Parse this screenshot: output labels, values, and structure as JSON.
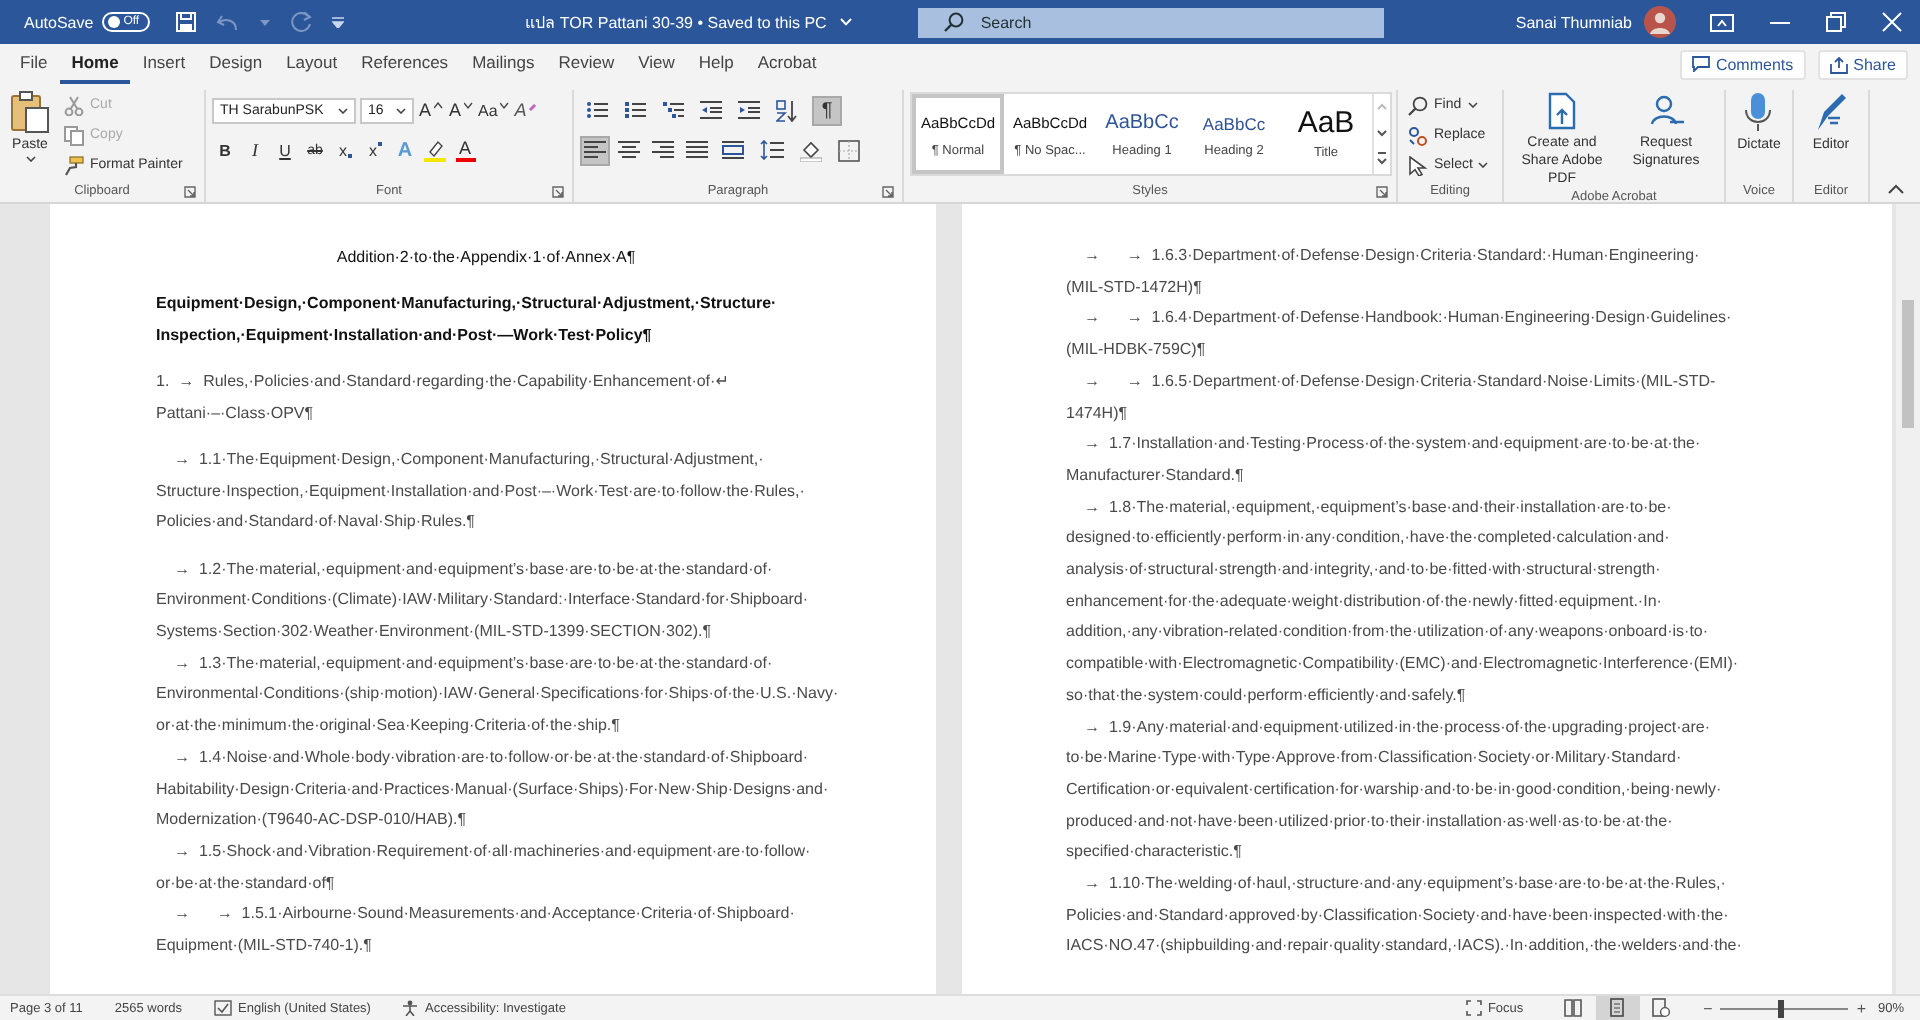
{
  "title_bar": {
    "autosave_label": "AutoSave",
    "autosave": {
      "text": "Off",
      "on": false
    },
    "document_title": "แปล TOR Pattani 30-39 • Saved to this PC",
    "search": {
      "placeholder": "Search"
    },
    "user_name": "Sanai Thumniab"
  },
  "ribbon_tabs": [
    {
      "label": "File",
      "selected": false
    },
    {
      "label": "Home",
      "selected": true
    },
    {
      "label": "Insert",
      "selected": false
    },
    {
      "label": "Design",
      "selected": false
    },
    {
      "label": "Layout",
      "selected": false
    },
    {
      "label": "References",
      "selected": false
    },
    {
      "label": "Mailings",
      "selected": false
    },
    {
      "label": "Review",
      "selected": false
    },
    {
      "label": "View",
      "selected": false
    },
    {
      "label": "Help",
      "selected": false
    },
    {
      "label": "Acrobat",
      "selected": false
    }
  ],
  "share_buttons": [
    "Comments",
    "Share"
  ],
  "clipboard": {
    "paste": "Paste",
    "label": "Clipboard",
    "items": [
      {
        "text": "Cut",
        "disabled": true,
        "kind": "cut"
      },
      {
        "text": "Copy",
        "disabled": true,
        "kind": "copy"
      },
      {
        "text": "Format Painter",
        "disabled": false,
        "kind": "painter"
      }
    ]
  },
  "font": {
    "label": "Font",
    "name": "TH SarabunPSK",
    "size": "16",
    "row1": [
      {
        "text": "A",
        "kind": "grow"
      },
      {
        "text": "A",
        "kind": "shrink"
      },
      {
        "text": "Aa",
        "kind": "case"
      },
      {
        "text": "A",
        "kind": "clear"
      }
    ],
    "row2": [
      {
        "text": "B",
        "kind": "bold"
      },
      {
        "text": "I",
        "kind": "italic"
      },
      {
        "text": "U",
        "kind": "underline"
      },
      {
        "text": "ab",
        "kind": "strike"
      },
      {
        "text": "x",
        "kind": "subscript"
      },
      {
        "text": "x",
        "kind": "superscript"
      },
      {
        "text": "A",
        "kind": "effects"
      },
      {
        "text": "A",
        "kind": "color"
      }
    ]
  },
  "paragraph": {
    "label": "Paragraph",
    "marks_button": {
      "text": "¶",
      "on": true
    },
    "alignment": [
      {
        "selected": true
      },
      {
        "selected": false
      },
      {
        "selected": false
      },
      {
        "selected": false
      }
    ]
  },
  "styles": {
    "label": "Styles",
    "items": [
      {
        "sample": "AaBbCcDd",
        "name": "¶ Normal",
        "selected": true,
        "kind": "body"
      },
      {
        "sample": "AaBbCcDd",
        "name": "¶ No Spac...",
        "selected": false,
        "kind": "body"
      },
      {
        "sample": "AaBbCc",
        "name": "Heading 1",
        "selected": false,
        "kind": "heading1"
      },
      {
        "sample": "AaBbCc",
        "name": "Heading 2",
        "selected": false,
        "kind": "heading2"
      },
      {
        "sample": "AaB",
        "name": "Title",
        "selected": false,
        "kind": "title"
      }
    ]
  },
  "editing": {
    "label": "Editing",
    "items": [
      {
        "text": "Find",
        "kind": "find"
      },
      {
        "text": "Replace",
        "kind": "replace"
      },
      {
        "text": "Select",
        "kind": "select"
      }
    ]
  },
  "acrobat": {
    "label": "Adobe Acrobat",
    "items": [
      {
        "text": "Create and Share Adobe PDF",
        "kind": "pdf"
      },
      {
        "text": "Request Signatures",
        "kind": "sign"
      }
    ]
  },
  "voice": {
    "label": "Voice",
    "button": "Dictate"
  },
  "editor": {
    "label": "Editor",
    "button": "Editor"
  },
  "document": {
    "pages": [
      {
        "paragraphs": [
          {
            "kind": "title",
            "lines": [
              "Addition·2·to·the·Appendix·1·of·Annex·A¶"
            ]
          },
          {
            "kind": "heading",
            "lines": [
              "Equipment·Design,·Component·Manufacturing,·Structural·Adjustment,·Structure·",
              "Inspection,·Equipment·Installation·and·Post·—Work·Test·Policy¶"
            ]
          },
          {
            "kind": "body",
            "lines": [
              "1.  →  Rules,·Policies·and·Standard·regarding·the·Capability·Enhancement·of·↵",
              "Pattani·–·Class·OPV¶"
            ]
          },
          {
            "kind": "item",
            "lines": [
              "→  1.1·The·Equipment·Design,·Component·Manufacturing,·Structural·Adjustment,·",
              "Structure·Inspection,·Equipment·Installation·and·Post·–·Work·Test·are·to·follow·the·Rules,·",
              "Policies·and·Standard·of·Naval·Ship·Rules.¶"
            ]
          },
          {
            "kind": "item",
            "lines": [
              "→  1.2·The·material,·equipment·and·equipment’s·base·are·to·be·at·the·standard·of·",
              "Environment·Conditions·(Climate)·IAW·Military·Standard:·Interface·Standard·for·Shipboard·",
              "Systems·Section·302·Weather·Environment·(MIL-STD-1399·SECTION·302).¶"
            ]
          },
          {
            "kind": "item",
            "lines": [
              "→  1.3·The·material,·equipment·and·equipment’s·base·are·to·be·at·the·standard·of·",
              "Environmental·Conditions·(ship·motion)·IAW·General·Specifications·for·Ships·of·the·U.S.·Navy·",
              "or·at·the·minimum·the·original·Sea·Keeping·Criteria·of·the·ship.¶"
            ]
          },
          {
            "kind": "item",
            "lines": [
              "→  1.4·Noise·and·Whole·body·vibration·are·to·follow·or·be·at·the·standard·of·Shipboard·",
              "Habitability·Design·Criteria·and·Practices·Manual·(Surface·Ships)·For·New·Ship·Designs·and·",
              "Modernization·(T9640-AC-DSP-010/HAB).¶"
            ]
          },
          {
            "kind": "item",
            "lines": [
              "→  1.5·Shock·and·Vibration·Requirement·of·all·machineries·and·equipment·are·to·follow·",
              "or·be·at·the·standard·of¶"
            ]
          },
          {
            "kind": "item",
            "lines": [
              "→      →  1.5.1·Airbourne·Sound·Measurements·and·Acceptance·Criteria·of·Shipboard·",
              "Equipment·(MIL-STD-740-1).¶"
            ]
          }
        ]
      },
      {
        "paragraphs": [
          {
            "kind": "item",
            "lines": [
              "→      →  1.6.3·Department·of·Defense·Design·Criteria·Standard:·Human·Engineering·",
              "(MIL-STD-1472H)¶"
            ]
          },
          {
            "kind": "item",
            "lines": [
              "→      →  1.6.4·Department·of·Defense·Handbook:·Human·Engineering·Design·Guidelines·",
              "(MIL-HDBK-759C)¶"
            ]
          },
          {
            "kind": "item",
            "lines": [
              "→      →  1.6.5·Department·of·Defense·Design·Criteria·Standard·Noise·Limits·(MIL-STD-",
              "1474H)¶"
            ]
          },
          {
            "kind": "item",
            "lines": [
              "→  1.7·Installation·and·Testing·Process·of·the·system·and·equipment·are·to·be·at·the·",
              "Manufacturer·Standard.¶"
            ]
          },
          {
            "kind": "item",
            "lines": [
              "→  1.8·The·material,·equipment,·equipment’s·base·and·their·installation·are·to·be·",
              "designed·to·efficiently·perform·in·any·condition,·have·the·completed·calculation·and·",
              "analysis·of·structural·strength·and·integrity,·and·to·be·fitted·with·structural·strength·",
              "enhancement·for·the·adequate·weight·distribution·of·the·newly·fitted·equipment.·In·",
              "addition,·any·vibration-related·condition·from·the·utilization·of·any·weapons·onboard·is·to·",
              "compatible·with·Electromagnetic·Compatibility·(EMC)·and·Electromagnetic·Interference·(EMI)·",
              "so·that·the·system·could·perform·efficiently·and·safely.¶"
            ]
          },
          {
            "kind": "item",
            "lines": [
              "→  1.9·Any·material·and·equipment·utilized·in·the·process·of·the·upgrading·project·are·",
              "to·be·Marine·Type·with·Type·Approve·from·Classification·Society·or·Military·Standard·",
              "Certification·or·equivalent·certification·for·warship·and·to·be·in·good·condition,·being·newly·",
              "produced·and·not·have·been·utilized·prior·to·their·installation·as·well·as·to·be·at·the·",
              "specified·characteristic.¶"
            ]
          },
          {
            "kind": "item",
            "lines": [
              "→  1.10·The·welding·of·haul,·structure·and·any·equipment’s·base·are·to·be·at·the·Rules,·",
              "Policies·and·Standard·approved·by·Classification·Society·and·have·been·inspected·with·the·",
              "IACS·NO.47·(shipbuilding·and·repair·quality·standard,·IACS).·In·addition,·the·welders·and·the·"
            ]
          }
        ]
      }
    ]
  },
  "status_bar": {
    "items": [
      {
        "text": "Page 3 of 11",
        "kind": "plain"
      },
      {
        "text": "2565 words",
        "kind": "plain"
      },
      {
        "text": "English (United States)",
        "kind": "language"
      },
      {
        "text": "Accessibility: Investigate",
        "kind": "accessibility"
      }
    ],
    "focus": "Focus",
    "views": [
      {
        "selected": false,
        "kind": "read"
      },
      {
        "selected": true,
        "kind": "print"
      },
      {
        "selected": false,
        "kind": "web"
      }
    ],
    "zoom": {
      "minus": "−",
      "plus": "+",
      "level": 0.47,
      "reading": "90%"
    }
  }
}
